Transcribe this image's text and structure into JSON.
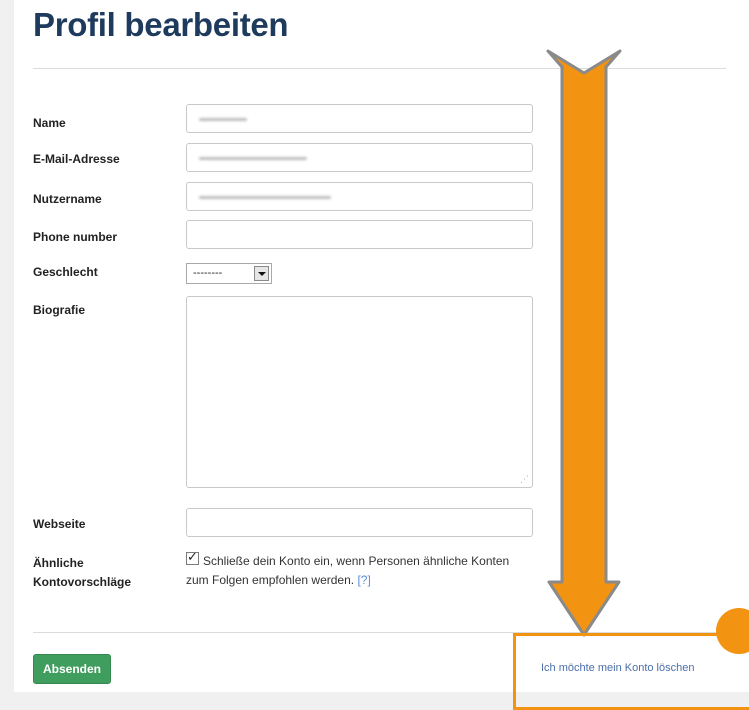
{
  "page": {
    "title": "Profil bearbeiten"
  },
  "form": {
    "name_label": "Name",
    "email_label": "E-Mail-Adresse",
    "username_label": "Nutzername",
    "phone_label": "Phone number",
    "phone_value": "",
    "gender_label": "Geschlecht",
    "gender_value": "--------",
    "bio_label": "Biografie",
    "bio_value": "",
    "website_label": "Webseite",
    "website_value": "",
    "suggestions_label_line1": "Ähnliche",
    "suggestions_label_line2": "Kontovorschläge",
    "suggestions_checked": true,
    "suggestions_text": "Schließe dein Konto ein, wenn Personen ähnliche Konten zum Folgen empfohlen werden.",
    "help_link": "[?]"
  },
  "footer": {
    "submit_label": "Absenden",
    "delete_label": "Ich möchte mein Konto löschen"
  },
  "annotation": {
    "color": "#f29312",
    "type": "arrow-down"
  },
  "colors": {
    "title": "#1e3a5c",
    "submit": "#3f9e5d",
    "link": "#4b6faa"
  }
}
